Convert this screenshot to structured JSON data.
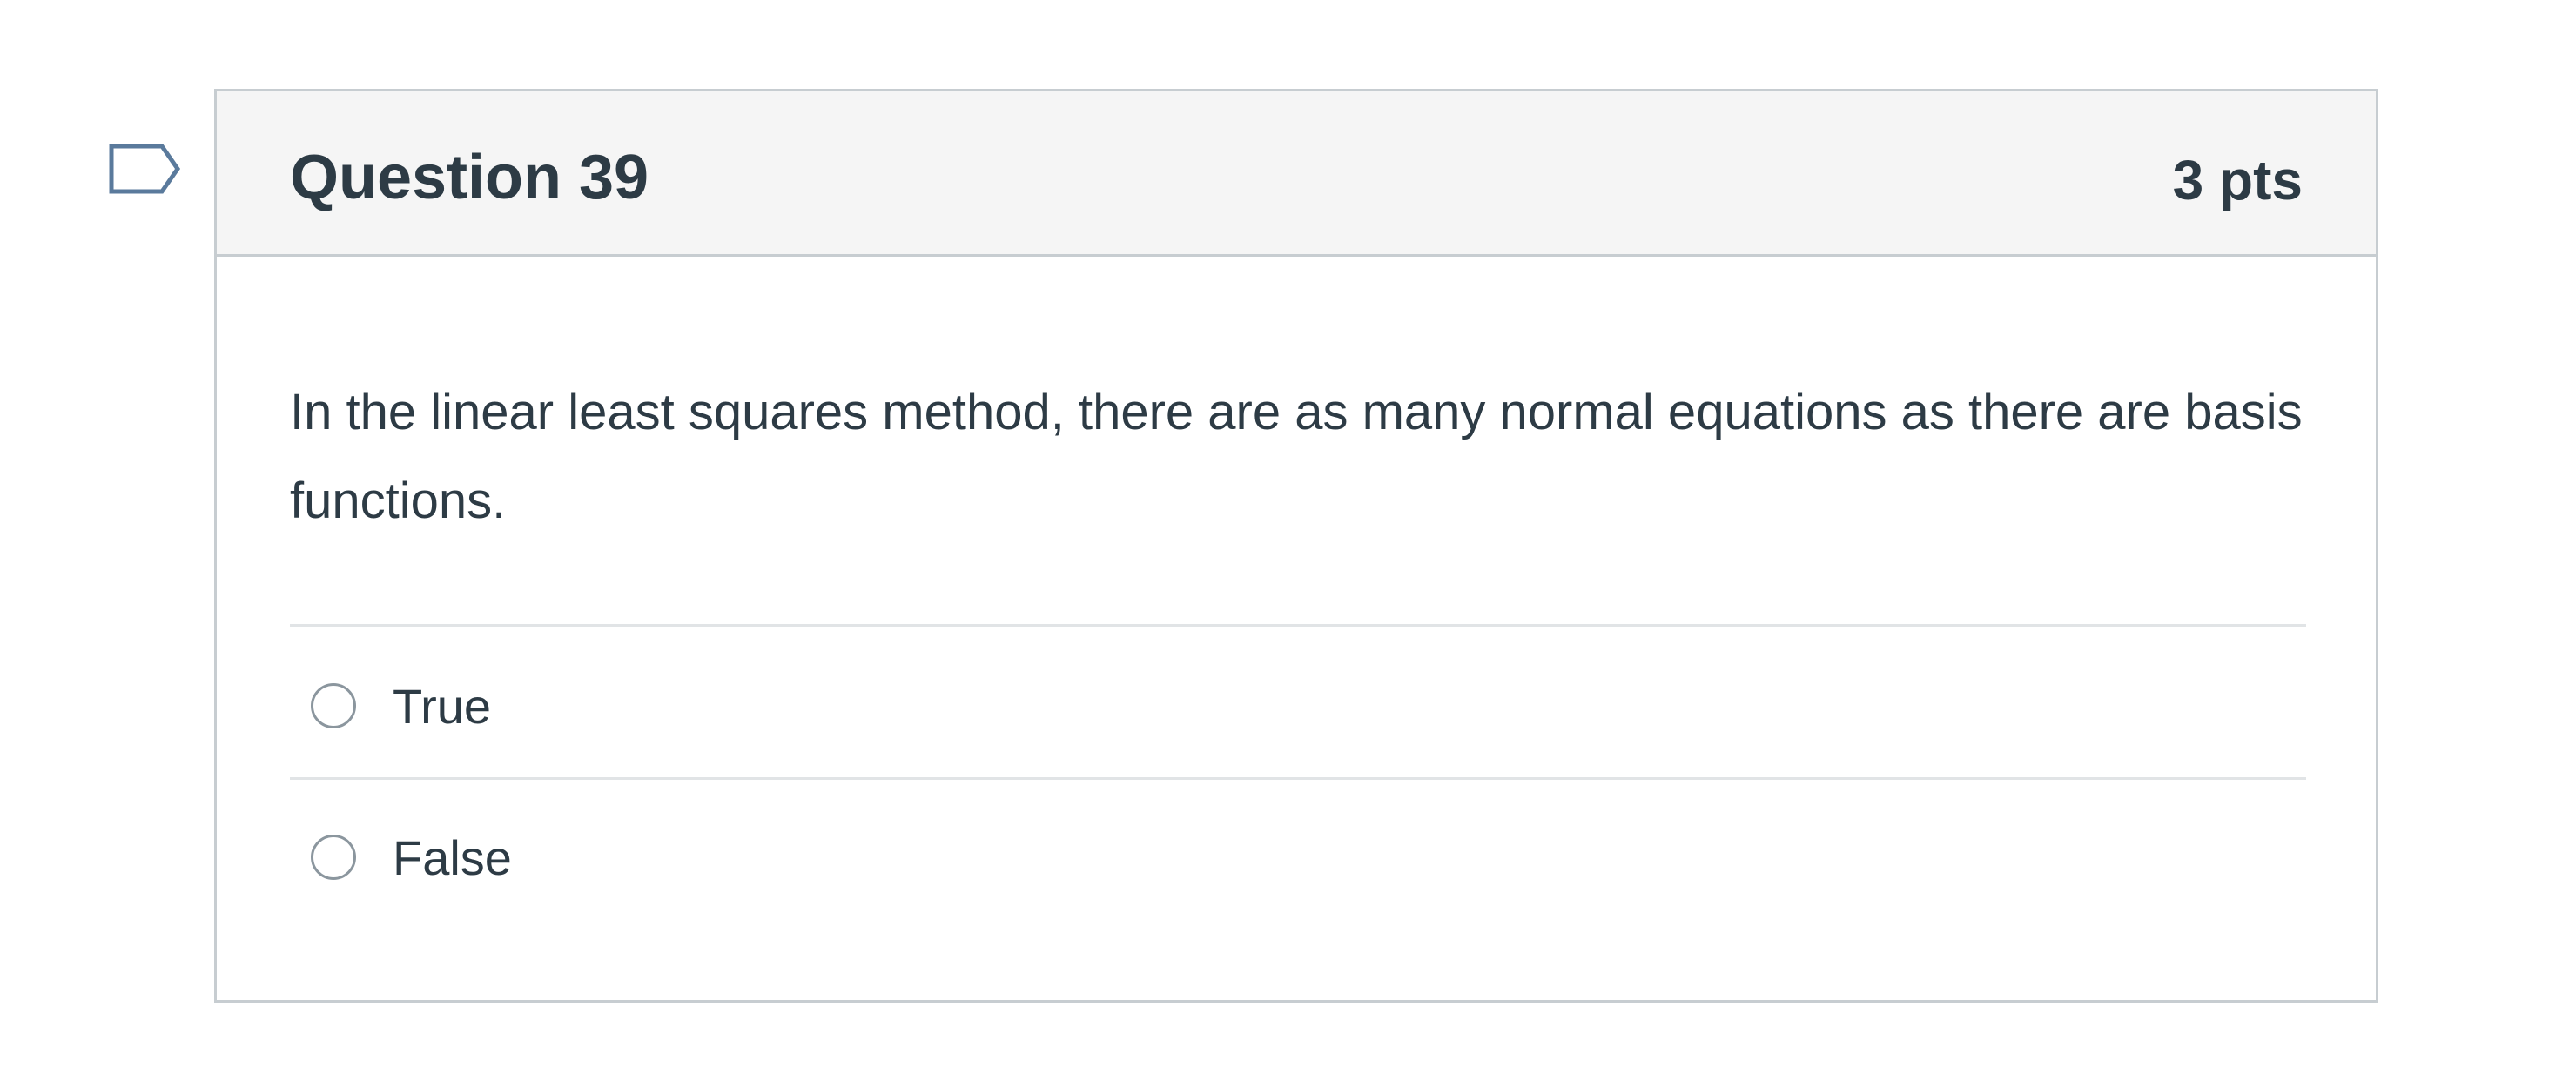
{
  "question": {
    "title": "Question 39",
    "points": "3 pts",
    "text": "In the linear least squares method, there are as many normal equations as there are basis functions.",
    "answers": [
      {
        "label": "True",
        "selected": false
      },
      {
        "label": "False",
        "selected": false
      }
    ],
    "flag_icon": "flag-question-icon"
  },
  "colors": {
    "text": "#2d3b45",
    "header_bg": "#f5f5f5",
    "border": "#c7cdd1",
    "flag": "#5a7a9c"
  }
}
